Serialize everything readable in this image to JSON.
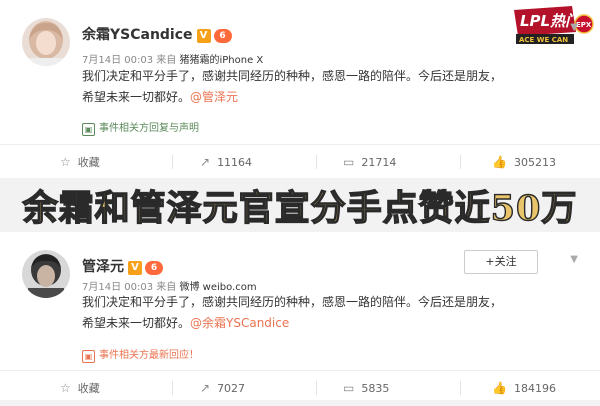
{
  "post1": {
    "username": "余霜YSCandice",
    "verified_badge": "V",
    "level_badge": "6",
    "date": "7月14日 00:03",
    "source_prefix": "来自",
    "source": "猪猪霜的iPhone X",
    "content_line1": "我们决定和平分手了，感谢共同经历的种种，感恩一路的陪伴。今后还是朋友，",
    "content_line2": "希望未来一切都好。",
    "mention": "@管泽元",
    "event_text": "事件相关方回复与声明",
    "actions": {
      "favorite": "收藏",
      "repost": "11164",
      "comment": "21714",
      "like": "305213"
    },
    "logo_text": {
      "top": "LPL热门",
      "bottom": "ACE WE CAN",
      "side": "EPX"
    }
  },
  "banner": {
    "title": "余霜和管泽元官宣分手点赞近50万"
  },
  "post2": {
    "username": "管泽元",
    "verified_badge": "V",
    "level_badge": "6",
    "follow_label": "+关注",
    "date": "7月14日 00:03",
    "source_prefix": "来自",
    "source": "微博 weibo.com",
    "content_line1": "我们决定和平分手了，感谢共同经历的种种，感恩一路的陪伴。今后还是朋友，",
    "content_line2": "希望未来一切都好。",
    "mention": "@余霜YSCandice",
    "event_text": "事件相关方最新回应！",
    "actions": {
      "favorite": "收藏",
      "repost": "7027",
      "comment": "5835",
      "like": "184196"
    }
  },
  "icons": {
    "favorite": "star-icon",
    "repost": "repost-icon",
    "comment": "comment-icon",
    "like": "thumbs-up-icon",
    "event": "event-icon",
    "more": "chevron-down-icon"
  },
  "colors": {
    "mention": "#eb7350",
    "event": "#5a8a5a",
    "banner_fill": "#e9c46a",
    "badge": "#f7a01a"
  }
}
